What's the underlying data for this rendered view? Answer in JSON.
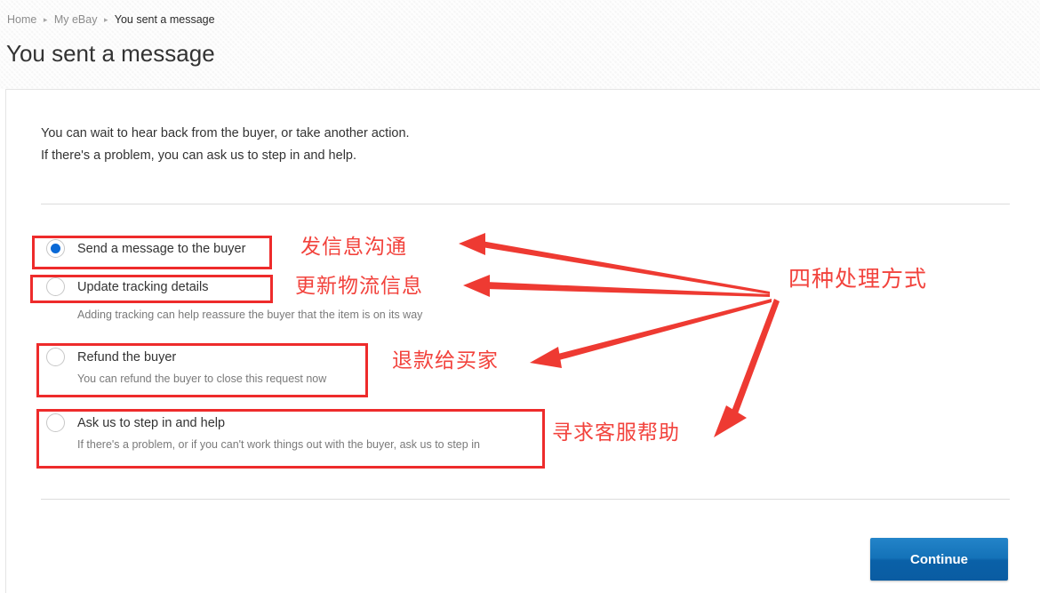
{
  "breadcrumb": {
    "items": [
      {
        "label": "Home",
        "current": false
      },
      {
        "label": "My eBay",
        "current": false
      },
      {
        "label": "You sent a message",
        "current": true
      }
    ],
    "separator": "▸"
  },
  "header": {
    "title": "You sent a message"
  },
  "main": {
    "intro_line_1": "You can wait to hear back from the buyer, or take another action.",
    "intro_line_2": "If there's a problem, you can ask us to step in and help.",
    "options": [
      {
        "id": "send-message",
        "label": "Send a message to the buyer",
        "sub": "",
        "selected": true
      },
      {
        "id": "update-tracking",
        "label": "Update tracking details",
        "sub": "Adding tracking can help reassure the buyer that the item is on its way",
        "selected": false
      },
      {
        "id": "refund-buyer",
        "label": "Refund the buyer",
        "sub": "You can refund the buyer to close this request now",
        "selected": false
      },
      {
        "id": "ask-us-step-in",
        "label": "Ask us to step in and help",
        "sub": "If there's a problem, or if you can't work things out with the buyer, ask us to step in",
        "selected": false
      }
    ],
    "continue_label": "Continue"
  },
  "annotations": {
    "color": "#f2433d",
    "notes": [
      {
        "id": "note-send-message",
        "text": "发信息沟通"
      },
      {
        "id": "note-update-tracking",
        "text": "更新物流信息"
      },
      {
        "id": "note-refund",
        "text": "退款给买家"
      },
      {
        "id": "note-ask-help",
        "text": "寻求客服帮助"
      },
      {
        "id": "note-summary",
        "text": "四种处理方式"
      }
    ]
  },
  "colors": {
    "accent_blue": "#0a61a8",
    "annotation_red": "#f2433d",
    "radio_blue": "#0a69d6",
    "header_band": "#f6f6f6"
  }
}
